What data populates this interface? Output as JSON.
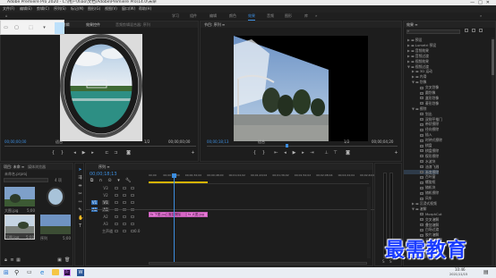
{
  "window": {
    "title": "Adobe Premiere Pro 2020 - C:\\用户\\Xiao\\文档\\Adobe\\Premiere Pro\\14.0\\未命",
    "controls": [
      "—",
      "□",
      "✕"
    ]
  },
  "menu": [
    "文件(F)",
    "编辑(E)",
    "剪辑(C)",
    "序列(S)",
    "标记(M)",
    "图形(G)",
    "视图(V)",
    "窗口(W)",
    "帮助(H)"
  ],
  "workspaces": {
    "items": [
      "学习",
      "组件",
      "编辑",
      "颜色",
      "效果",
      "音频",
      "图形",
      "库"
    ],
    "active_index": 4
  },
  "source_monitor": {
    "tabs": [
      "源: 无剪辑",
      "效果控件",
      "音频剪辑混合器: 序列"
    ],
    "timecode_left": "00;00;00;00",
    "fit": "适合",
    "ratio": "1/2",
    "timecode_right": "00;00;00;00"
  },
  "program_monitor": {
    "tab": "节目: 序列 ≡",
    "timecode_left": "00;00;18;13",
    "fit": "适合",
    "ratio": "1/2",
    "timecode_right": "00;00;04;20"
  },
  "project_panel": {
    "tabs": [
      "项目: 未命 ≡",
      "媒体浏览器"
    ],
    "path": "未命名.prproj",
    "item_count": "4 项",
    "items": [
      {
        "name": "大图.jpg",
        "duration": "5;00"
      },
      {
        "name": "",
        "duration": ""
      },
      {
        "name": "下图.jpg",
        "duration": "5;00"
      },
      {
        "name": "序列",
        "duration": "5;00"
      }
    ]
  },
  "timeline": {
    "tab": "序列 ≡",
    "timecode": "00;00;18;13",
    "ruler": [
      "00;00",
      "00;00;16;00",
      "00;00;32;00",
      "00;00;48;00",
      "00;01;04;02",
      "00;01;20;02",
      "00;01;36;02",
      "00;01;52;02",
      "00;02;08;04",
      "00;02;24;04",
      "00;02;40;04"
    ],
    "tracks": [
      {
        "target": "",
        "label": "V3"
      },
      {
        "target": "",
        "label": "V2"
      },
      {
        "target": "V1",
        "label": "V1"
      },
      {
        "target": "A1",
        "label": "A1"
      },
      {
        "target": "",
        "label": "A2"
      },
      {
        "target": "",
        "label": "A3"
      },
      {
        "target": "",
        "label": "主声道"
      }
    ],
    "master_value": "0.0",
    "clips": [
      {
        "label": "fx 下图.jpg"
      },
      {
        "label": "渐变擦除"
      },
      {
        "label": "fx 大图.jpg"
      }
    ]
  },
  "effects_panel": {
    "title": "效果 ≡",
    "tree": [
      {
        "level": 0,
        "twist": "▶",
        "label": "预设"
      },
      {
        "level": 0,
        "twist": "▶",
        "label": "Lumetri 预设"
      },
      {
        "level": 0,
        "twist": "▶",
        "label": "音频效果"
      },
      {
        "level": 0,
        "twist": "▶",
        "label": "音频过渡"
      },
      {
        "level": 0,
        "twist": "▶",
        "label": "视频效果"
      },
      {
        "level": 0,
        "twist": "▼",
        "label": "视频过渡"
      },
      {
        "level": 1,
        "twist": "▶",
        "label": "3D 运动"
      },
      {
        "level": 1,
        "twist": "▶",
        "label": "内滑"
      },
      {
        "level": 1,
        "twist": "▼",
        "label": "划像"
      },
      {
        "level": 2,
        "twist": "",
        "label": "交叉划像"
      },
      {
        "level": 2,
        "twist": "",
        "label": "圆划像"
      },
      {
        "level": 2,
        "twist": "",
        "label": "盒形划像"
      },
      {
        "level": 2,
        "twist": "",
        "label": "菱形划像"
      },
      {
        "level": 1,
        "twist": "▼",
        "label": "擦除"
      },
      {
        "level": 2,
        "twist": "",
        "label": "划出"
      },
      {
        "level": 2,
        "twist": "",
        "label": "双侧平推门"
      },
      {
        "level": 2,
        "twist": "",
        "label": "带状擦除"
      },
      {
        "level": 2,
        "twist": "",
        "label": "径向擦除"
      },
      {
        "level": 2,
        "twist": "",
        "label": "插入"
      },
      {
        "level": 2,
        "twist": "",
        "label": "时钟式擦除"
      },
      {
        "level": 2,
        "twist": "",
        "label": "棋盘"
      },
      {
        "level": 2,
        "twist": "",
        "label": "棋盘擦除"
      },
      {
        "level": 2,
        "twist": "",
        "label": "楔形擦除"
      },
      {
        "level": 2,
        "twist": "",
        "label": "水波块"
      },
      {
        "level": 2,
        "twist": "",
        "label": "油漆飞溅"
      },
      {
        "level": 2,
        "twist": "",
        "label": "渐变擦除"
      },
      {
        "level": 2,
        "twist": "",
        "label": "百叶窗"
      },
      {
        "level": 2,
        "twist": "",
        "label": "螺旋框"
      },
      {
        "level": 2,
        "twist": "",
        "label": "随机块"
      },
      {
        "level": 2,
        "twist": "",
        "label": "随机擦除"
      },
      {
        "level": 2,
        "twist": "",
        "label": "风车"
      },
      {
        "level": 1,
        "twist": "▶",
        "label": "沉浸式视频"
      },
      {
        "level": 1,
        "twist": "▼",
        "label": "溶解"
      },
      {
        "level": 2,
        "twist": "",
        "label": "MorphCut"
      },
      {
        "level": 2,
        "twist": "",
        "label": "交叉溶解"
      },
      {
        "level": 2,
        "twist": "",
        "label": "叠加溶解"
      },
      {
        "level": 2,
        "twist": "",
        "label": "白场过渡"
      },
      {
        "level": 2,
        "twist": "",
        "label": "胶片溶解"
      },
      {
        "level": 2,
        "twist": "",
        "label": "非叠加溶解"
      },
      {
        "level": 2,
        "twist": "",
        "label": "黑场过渡"
      },
      {
        "level": 1,
        "twist": "▶",
        "label": "缩放"
      },
      {
        "level": 1,
        "twist": "▶",
        "label": "页面剥落"
      }
    ]
  },
  "taskbar": {
    "time": "10:46",
    "date": "2021/11/15",
    "icons": [
      "windows-start",
      "search",
      "task-view",
      "edge",
      "explorer",
      "premiere",
      "word"
    ]
  },
  "watermark": "最需教育"
}
